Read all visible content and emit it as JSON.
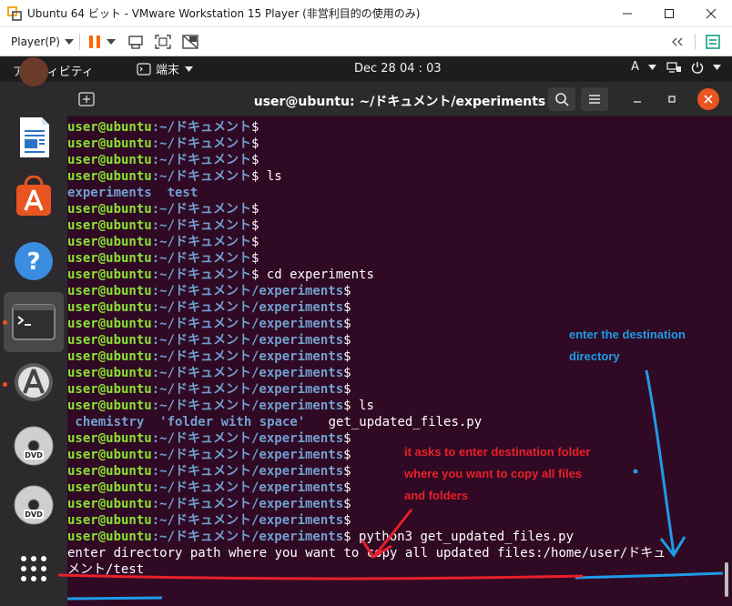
{
  "window": {
    "title": "Ubuntu 64 ビット - VMware Workstation 15 Player (非営利目的の使用のみ)",
    "controls": [
      "minimize-icon",
      "maximize-icon",
      "close-icon"
    ]
  },
  "vm_toolbar": {
    "player_menu": "Player(P)",
    "icons": [
      "pause-icon",
      "dropdown-icon",
      "send-ctrl-alt-del-icon",
      "fullscreen-icon",
      "unity-icon",
      "double-chevron-left-icon",
      "devices-icon"
    ],
    "accent": "#ff6600"
  },
  "gnome": {
    "activities": "アクティビティ",
    "app_menu": "端末",
    "clock": "Dec 28  04 : 03",
    "input_method": "A"
  },
  "dock": {
    "items": [
      "text-editor-icon",
      "software-center-icon",
      "help-icon",
      "terminal-icon",
      "software-updater-icon",
      "dvd-icon",
      "dvd-icon",
      "show-applications-icon"
    ]
  },
  "terminal": {
    "title": "user@ubuntu: ~/ドキュメント/experiments",
    "background": "#300a24",
    "lines": [
      {
        "user": "user@ubuntu",
        "path": ":~/ドキュメント",
        "cmd": "$"
      },
      {
        "user": "user@ubuntu",
        "path": ":~/ドキュメント",
        "cmd": "$"
      },
      {
        "user": "user@ubuntu",
        "path": ":~/ドキュメント",
        "cmd": "$"
      },
      {
        "user": "user@ubuntu",
        "path": ":~/ドキュメント",
        "cmd": "$ ls"
      },
      {
        "output_dirs": "experiments  test"
      },
      {
        "user": "user@ubuntu",
        "path": ":~/ドキュメント",
        "cmd": "$"
      },
      {
        "user": "user@ubuntu",
        "path": ":~/ドキュメント",
        "cmd": "$"
      },
      {
        "user": "user@ubuntu",
        "path": ":~/ドキュメント",
        "cmd": "$"
      },
      {
        "user": "user@ubuntu",
        "path": ":~/ドキュメント",
        "cmd": "$"
      },
      {
        "user": "user@ubuntu",
        "path": ":~/ドキュメント",
        "cmd": "$ cd experiments"
      },
      {
        "user": "user@ubuntu",
        "path": ":~/ドキュメント/experiments",
        "cmd": "$"
      },
      {
        "user": "user@ubuntu",
        "path": ":~/ドキュメント/experiments",
        "cmd": "$"
      },
      {
        "user": "user@ubuntu",
        "path": ":~/ドキュメント/experiments",
        "cmd": "$"
      },
      {
        "user": "user@ubuntu",
        "path": ":~/ドキュメント/experiments",
        "cmd": "$"
      },
      {
        "user": "user@ubuntu",
        "path": ":~/ドキュメント/experiments",
        "cmd": "$"
      },
      {
        "user": "user@ubuntu",
        "path": ":~/ドキュメント/experiments",
        "cmd": "$"
      },
      {
        "user": "user@ubuntu",
        "path": ":~/ドキュメント/experiments",
        "cmd": "$"
      },
      {
        "user": "user@ubuntu",
        "path": ":~/ドキュメント/experiments",
        "cmd": "$ ls"
      },
      {
        "output_dirs": " chemistry  'folder with space'",
        "output_files": "   get_updated_files.py"
      },
      {
        "user": "user@ubuntu",
        "path": ":~/ドキュメント/experiments",
        "cmd": "$"
      },
      {
        "user": "user@ubuntu",
        "path": ":~/ドキュメント/experiments",
        "cmd": "$"
      },
      {
        "user": "user@ubuntu",
        "path": ":~/ドキュメント/experiments",
        "cmd": "$"
      },
      {
        "user": "user@ubuntu",
        "path": ":~/ドキュメント/experiments",
        "cmd": "$"
      },
      {
        "user": "user@ubuntu",
        "path": ":~/ドキュメント/experiments",
        "cmd": "$"
      },
      {
        "user": "user@ubuntu",
        "path": ":~/ドキュメント/experiments",
        "cmd": "$"
      },
      {
        "user": "user@ubuntu",
        "path": ":~/ドキュメント/experiments",
        "cmd": "$ python3 get_updated_files.py"
      },
      {
        "plain": "enter directory path where you want to copy all updated files:/home/user/ドキュ"
      },
      {
        "plain": "メント/test"
      }
    ]
  },
  "annotations": {
    "blue_note": [
      "enter the destination",
      "directory"
    ],
    "red_note": [
      "it asks to enter destination folder",
      "where you want to copy all files",
      "and folders"
    ],
    "blue": "#1f9be8",
    "red": "#e8202a"
  }
}
